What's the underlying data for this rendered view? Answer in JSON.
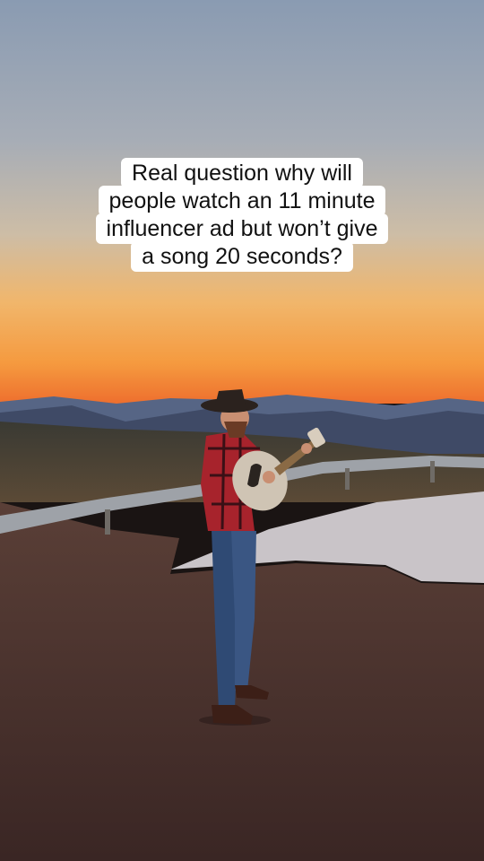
{
  "caption": {
    "lines": [
      "Real question why will",
      "people watch an 11 minute",
      "influencer ad but won’t give",
      "a song 20 seconds?"
    ]
  },
  "scene": {
    "description_icon": "musician-guitar-sunset-overlook",
    "colors": {
      "sky_top": "#8b9db3",
      "sky_mid": "#c7b8a6",
      "horizon": "#f08a3a",
      "mountains": "#3e4a66",
      "ground": "#4a3430"
    }
  }
}
